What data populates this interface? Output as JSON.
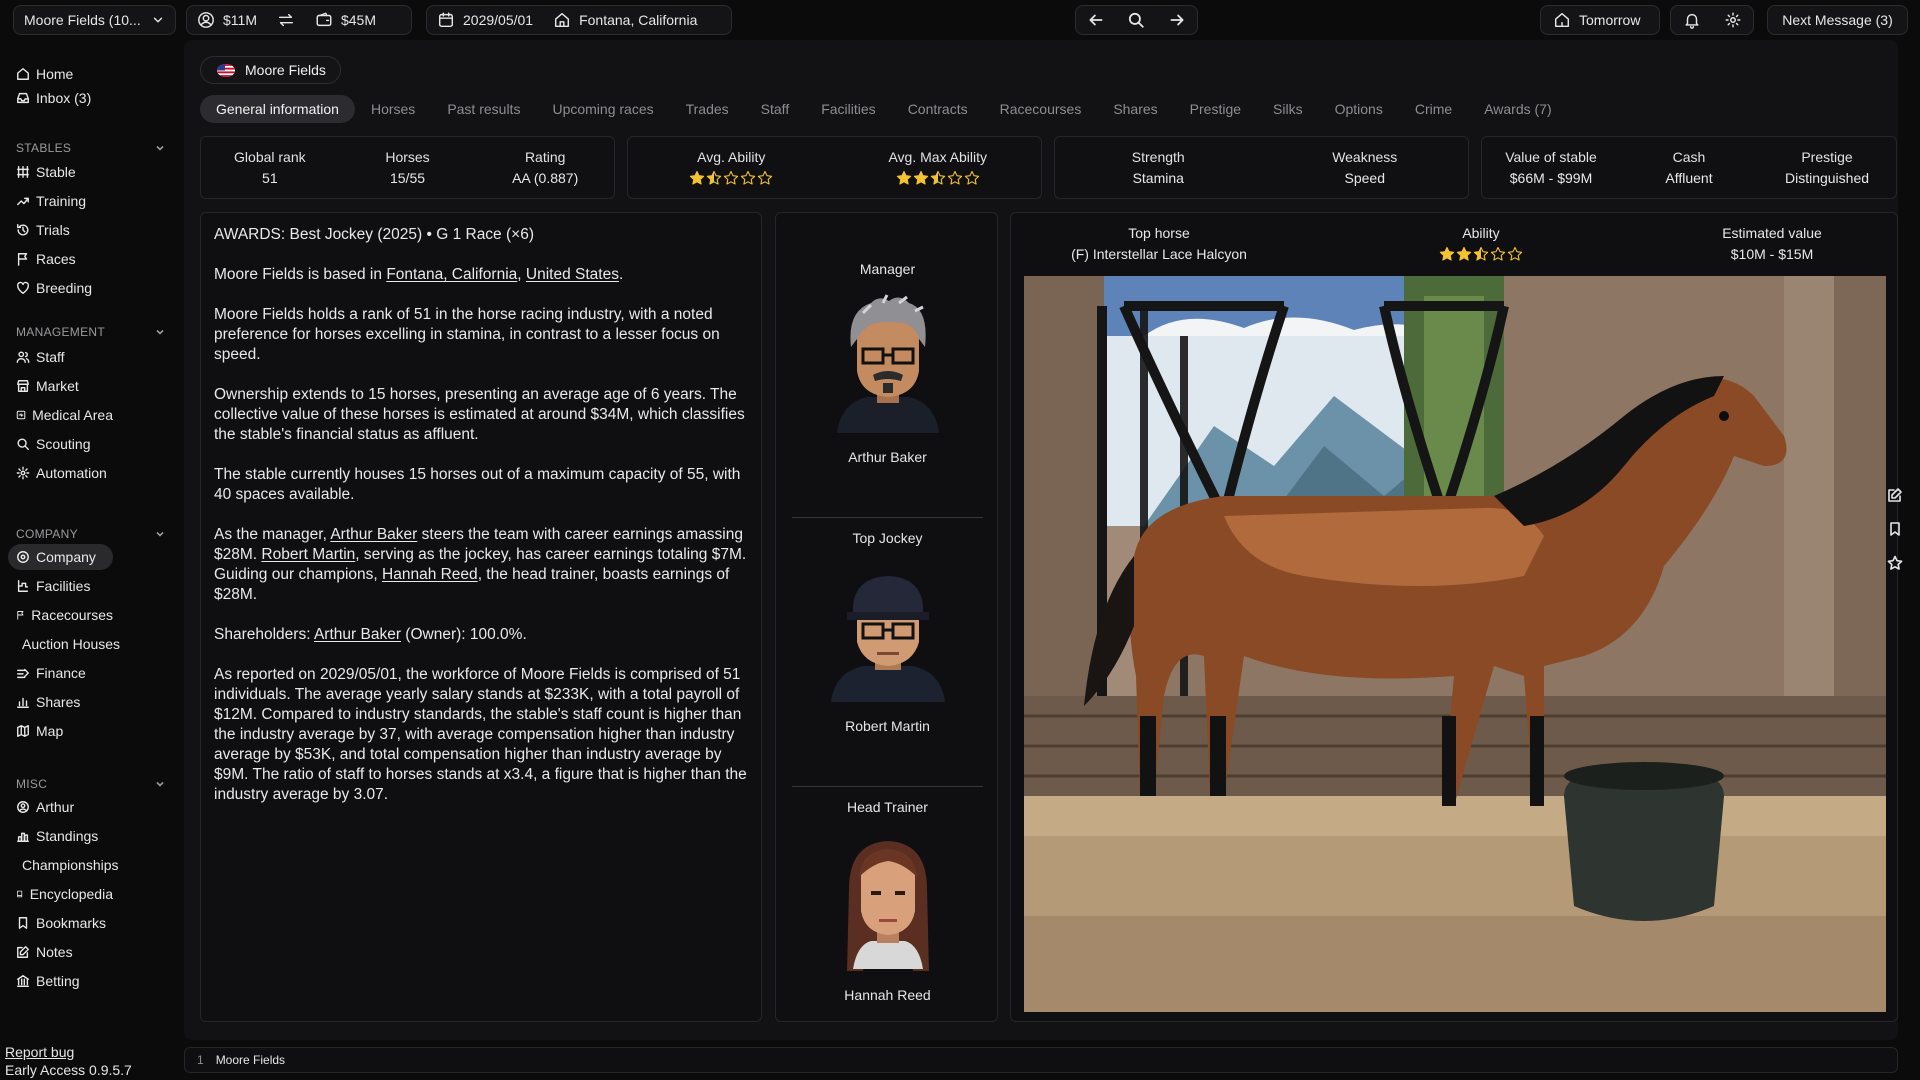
{
  "topbar": {
    "stable_select": "Moore Fields (10...",
    "money_personal": "$11M",
    "money_stable": "$45M",
    "date": "2029/05/01",
    "location": "Fontana, California",
    "tomorrow_label": "Tomorrow",
    "next_message_label": "Next Message (3)"
  },
  "sidebar": {
    "top_items": [
      {
        "label": "Home",
        "icon": "home-icon"
      },
      {
        "label": "Inbox (3)",
        "icon": "inbox-icon"
      }
    ],
    "sections": [
      {
        "title": "STABLES",
        "items": [
          "Stable",
          "Training",
          "Trials",
          "Races",
          "Breeding"
        ]
      },
      {
        "title": "MANAGEMENT",
        "items": [
          "Staff",
          "Market",
          "Medical Area",
          "Scouting",
          "Automation"
        ]
      },
      {
        "title": "COMPANY",
        "items": [
          "Company",
          "Facilities",
          "Racecourses",
          "Auction Houses",
          "Finance",
          "Shares",
          "Map"
        ]
      },
      {
        "title": "MISC",
        "items": [
          "Arthur",
          "Standings",
          "Championships",
          "Encyclopedia",
          "Bookmarks",
          "Notes",
          "Betting"
        ]
      }
    ],
    "active_item": "Company",
    "report_bug": "Report bug",
    "version": "Early Access 0.9.5.7"
  },
  "stable_chip": "Moore Fields",
  "tabs": [
    "General information",
    "Horses",
    "Past results",
    "Upcoming races",
    "Trades",
    "Staff",
    "Facilities",
    "Contracts",
    "Racecourses",
    "Shares",
    "Prestige",
    "Silks",
    "Options",
    "Crime",
    "Awards (7)"
  ],
  "active_tab": "General information",
  "stats": {
    "global_rank": {
      "label": "Global rank",
      "value": "51"
    },
    "horses": {
      "label": "Horses",
      "value": "15/55"
    },
    "rating": {
      "label": "Rating",
      "value": "AA (0.887)"
    },
    "avg_ability": {
      "label": "Avg. Ability",
      "stars": 1.5
    },
    "avg_max_ability": {
      "label": "Avg. Max Ability",
      "stars": 2.5
    },
    "strength": {
      "label": "Strength",
      "value": "Stamina"
    },
    "weakness": {
      "label": "Weakness",
      "value": "Speed"
    },
    "value_of_stable": {
      "label": "Value of stable",
      "value": "$66M - $99M"
    },
    "cash": {
      "label": "Cash",
      "value": "Affluent"
    },
    "prestige": {
      "label": "Prestige",
      "value": "Distinguished"
    }
  },
  "description": {
    "awards": "AWARDS: Best Jockey (2025) • G 1 Race (×6)",
    "p1_pre": "Moore Fields is based in ",
    "p1_link1": "Fontana, California",
    "p1_sep": ", ",
    "p1_link2": "United States",
    "p1_post": ".",
    "p2": "Moore Fields holds a rank of 51 in the horse racing industry, with a noted preference for horses excelling in stamina, in contrast to a lesser focus on speed.",
    "p3": "Ownership extends to 15 horses, presenting an average age of 6 years. The collective value of these horses is estimated at around $34M, which classifies the stable's financial status as affluent.",
    "p4": "The stable currently houses 15 horses out of a maximum capacity of 55, with 40 spaces available.",
    "p5_a": "As the manager, ",
    "p5_manager": "Arthur Baker",
    "p5_b": " steers the team with career earnings amassing $28M. ",
    "p5_jockey": "Robert Martin",
    "p5_c": ", serving as the jockey, has career earnings totaling $7M. Guiding our champions, ",
    "p5_trainer": "Hannah Reed",
    "p5_d": ", the head trainer, boasts earnings of $28M.",
    "p6_a": "Shareholders: ",
    "p6_owner": "Arthur Baker",
    "p6_b": " (Owner): 100.0%.",
    "p7": "As reported on 2029/05/01, the workforce of Moore Fields is comprised of 51 individuals. The average yearly salary stands at $233K, with a total payroll of $12M. Compared to industry standards, the stable's staff count is higher than the industry average by 37, with average compensation higher than industry average by $53K, and total compensation higher than industry average by $9M. The ratio of staff to horses stands at x3.4, a figure that is higher than the industry average by 3.07."
  },
  "staff": [
    {
      "role": "Manager",
      "name": "Arthur Baker"
    },
    {
      "role": "Top Jockey",
      "name": "Robert Martin"
    },
    {
      "role": "Head Trainer",
      "name": "Hannah Reed"
    }
  ],
  "top_horse": {
    "label": "Top horse",
    "name": "(F) Interstellar Lace Halcyon",
    "ability_label": "Ability",
    "ability_stars": 2.5,
    "value_label": "Estimated value",
    "value": "$10M - $15M"
  },
  "bottom_bar": {
    "index": "1",
    "label": "Moore Fields"
  },
  "colors": {
    "star": "#f2c230",
    "active_bg": "#2a2a2d",
    "panel_border": "#26262a"
  }
}
